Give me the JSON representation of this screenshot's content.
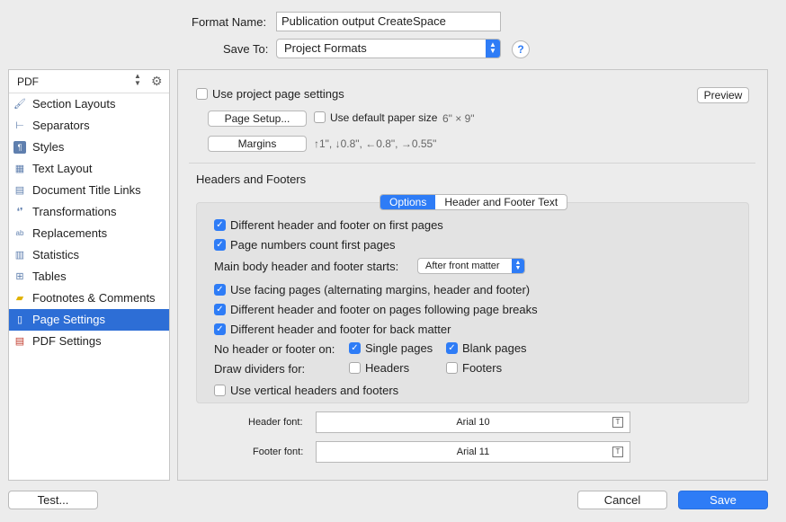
{
  "top": {
    "format_name_label": "Format Name:",
    "format_name_value": "Publication output CreateSpace",
    "save_to_label": "Save To:",
    "save_to_value": "Project Formats",
    "help_label": "?"
  },
  "sidebar": {
    "format_select": "PDF",
    "items": [
      {
        "label": "Section Layouts",
        "icon": "brush-icon"
      },
      {
        "label": "Separators",
        "icon": "separator-icon"
      },
      {
        "label": "Styles",
        "icon": "styles-icon"
      },
      {
        "label": "Text Layout",
        "icon": "text-layout-icon"
      },
      {
        "label": "Document Title Links",
        "icon": "document-icon"
      },
      {
        "label": "Transformations",
        "icon": "quotes-icon"
      },
      {
        "label": "Replacements",
        "icon": "replace-icon"
      },
      {
        "label": "Statistics",
        "icon": "statistics-icon"
      },
      {
        "label": "Tables",
        "icon": "table-icon"
      },
      {
        "label": "Footnotes & Comments",
        "icon": "comment-icon"
      },
      {
        "label": "Page Settings",
        "icon": "page-icon",
        "selected": true
      },
      {
        "label": "PDF Settings",
        "icon": "pdf-icon"
      }
    ]
  },
  "page": {
    "use_project_settings": "Use project page settings",
    "preview": "Preview",
    "page_setup": "Page Setup...",
    "use_default_paper": "Use default paper size",
    "paper_size": "6\" × 9\"",
    "margins": "Margins",
    "margin_values": "↑1\", ↓0.8\", ←0.8\", →0.55\""
  },
  "headers_footers": {
    "title": "Headers and Footers",
    "tabs": [
      "Options",
      "Header and Footer Text"
    ],
    "first_pages": "Different header and footer on first pages",
    "page_numbers": "Page numbers count first pages",
    "main_body_label": "Main body header and footer starts:",
    "main_body_value": "After front matter",
    "facing_pages": "Use facing pages (alternating margins, header and footer)",
    "page_breaks": "Different header and footer on pages following page breaks",
    "back_matter": "Different header and footer for back matter",
    "no_header_label": "No header or footer on:",
    "single_pages": "Single pages",
    "blank_pages": "Blank pages",
    "dividers_label": "Draw dividers for:",
    "headers": "Headers",
    "footers": "Footers",
    "vertical": "Use vertical headers and footers"
  },
  "fonts": {
    "header_label": "Header font:",
    "header_value": "Arial 10",
    "footer_label": "Footer font:",
    "footer_value": "Arial 11",
    "font_icon_glyph": "T"
  },
  "bottom": {
    "test": "Test...",
    "cancel": "Cancel",
    "save": "Save"
  },
  "colors": {
    "accent": "#2e7cf6",
    "selection": "#2d6ed6"
  }
}
